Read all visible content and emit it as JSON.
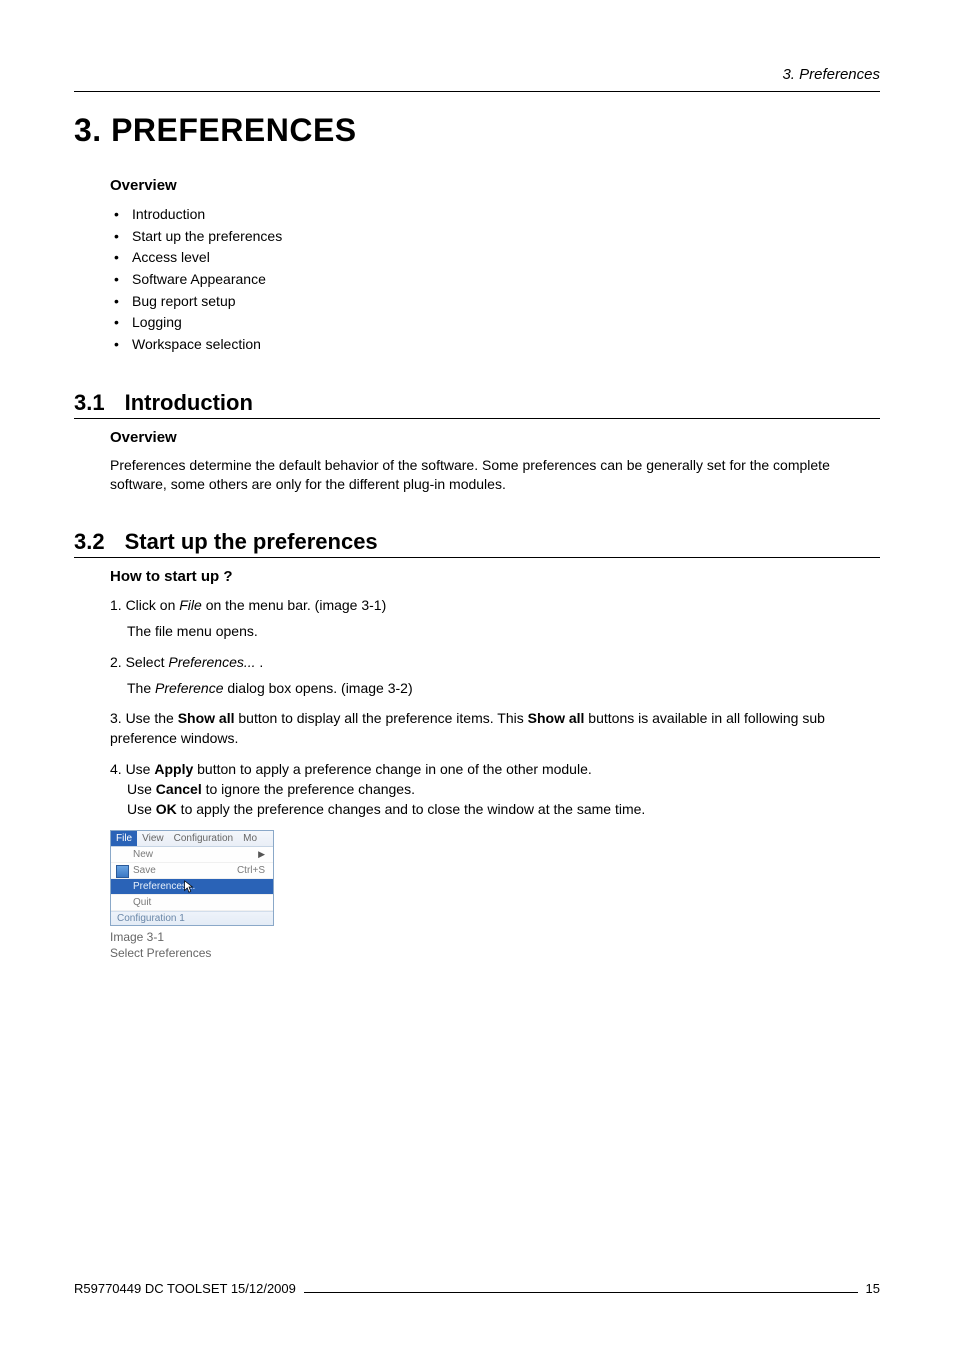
{
  "header": {
    "running": "3.  Preferences"
  },
  "chapter": {
    "title": "3. PREFERENCES"
  },
  "overview": {
    "heading": "Overview",
    "items": [
      "Introduction",
      "Start up the preferences",
      "Access level",
      "Software Appearance",
      "Bug report setup",
      "Logging",
      "Workspace selection"
    ]
  },
  "sec31": {
    "num": "3.1",
    "title": "Introduction",
    "subhead": "Overview",
    "para": "Preferences determine the default behavior of the software.  Some preferences can be generally set for the complete software, some others are only for the different plug-in modules."
  },
  "sec32": {
    "num": "3.2",
    "title": "Start up the preferences",
    "subhead": "How to start up ?",
    "step1_a": "1. Click on ",
    "step1_b": "File",
    "step1_c": " on the menu bar.  (image 3-1)",
    "step1_sub": "The file menu opens.",
    "step2_a": "2. Select ",
    "step2_b": "Preferences...",
    "step2_c": " .",
    "step2_sub_a": "The ",
    "step2_sub_b": "Preference",
    "step2_sub_c": " dialog box opens.  (image 3-2)",
    "step3_a": "3. Use the ",
    "step3_b": "Show all",
    "step3_c": " button to display all the preference items.  This ",
    "step3_d": "Show all",
    "step3_e": " buttons is available in all following sub preference windows.",
    "step4_a": "4. Use ",
    "step4_b": "Apply",
    "step4_c": " button to apply a preference change in one of the other module.",
    "step4_d": "Use ",
    "step4_e": "Cancel",
    "step4_f": " to ignore the preference changes.",
    "step4_g": "Use ",
    "step4_h": "OK",
    "step4_i": " to apply the preference changes and to close the window at the same time."
  },
  "screenshot": {
    "menubar": {
      "file": "File",
      "view": "View",
      "config": "Configuration",
      "more": "Mo"
    },
    "dd": {
      "new": "New",
      "save": "Save",
      "save_sc": "Ctrl+S",
      "prefs": "Preferences...",
      "quit": "Quit"
    },
    "status": "Configuration  1",
    "caption1": "Image 3-1",
    "caption2": "Select Preferences"
  },
  "footer": {
    "left": "R59770449  DC TOOLSET  15/12/2009",
    "right": "15"
  }
}
